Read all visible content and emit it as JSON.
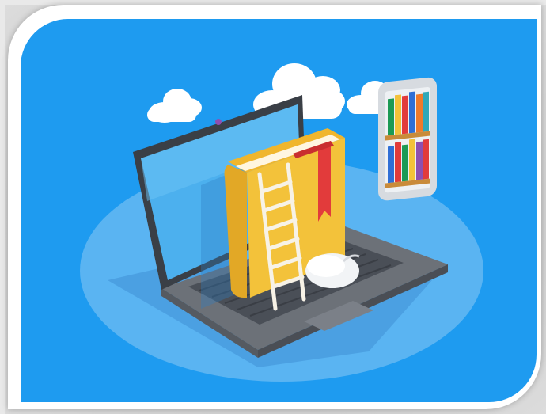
{
  "scene": {
    "subject": "online-library-illustration",
    "icons": [
      "laptop-icon",
      "book-icon",
      "ladder-icon",
      "bookmark-icon",
      "mouse-icon",
      "smartphone-bookshelf-icon",
      "cloud-icon"
    ],
    "colors": {
      "background": "#1e9bf0",
      "platform": "#5ab4f2",
      "laptop_body": "#8a8f96",
      "laptop_screen": "#4cb0ee",
      "book_cover": "#f3c23a",
      "book_spine": "#e2a826",
      "bookmark": "#e23b3b",
      "ladder": "#f7f2e6",
      "cloud": "#ffffff",
      "frame": "#ffffff"
    }
  }
}
